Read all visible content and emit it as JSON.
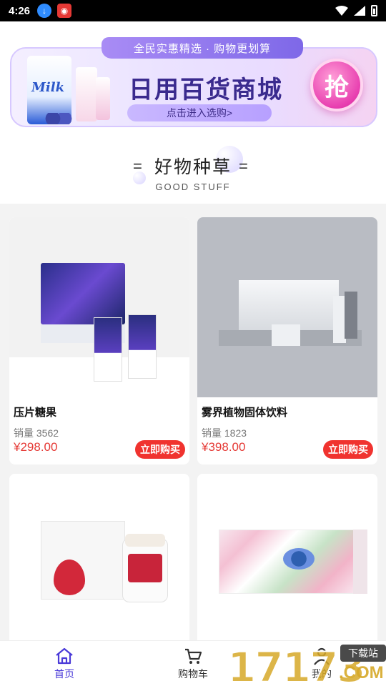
{
  "status_bar": {
    "time": "4:26",
    "icons": [
      "download-icon",
      "app-notification-icon",
      "wifi-icon",
      "signal-icon",
      "battery-icon"
    ]
  },
  "banner": {
    "tab_text": "全民实惠精选 · 购物更划算",
    "title": "日用百货商城",
    "cta": "点击进入选购>",
    "badge": "抢",
    "product_label": "Milk"
  },
  "section": {
    "title": "好物种草",
    "subtitle": "GOOD STUFF",
    "left_mark": "=",
    "right_mark": "="
  },
  "products": [
    {
      "name": "压片糖果",
      "sales_label": "销量 3562",
      "price": "¥298.00",
      "buy_label": "立即购买"
    },
    {
      "name": "雾界植物固体饮料",
      "sales_label": "销量 1823",
      "price": "¥398.00",
      "buy_label": "立即购买"
    },
    {
      "name": "",
      "sales_label": "",
      "price": "",
      "buy_label": ""
    },
    {
      "name": "",
      "sales_label": "",
      "price": "",
      "buy_label": ""
    }
  ],
  "bottom_nav": [
    {
      "label": "首页",
      "icon": "home-icon",
      "active": true
    },
    {
      "label": "购物车",
      "icon": "cart-icon",
      "active": false
    },
    {
      "label": "我的",
      "icon": "user-icon",
      "active": false
    }
  ],
  "watermark": {
    "digits": "17173",
    "domain": ".COM",
    "tag": "下载站"
  },
  "colors": {
    "accent": "#4a3ad8",
    "price": "#e53935",
    "buy_button": "#f0332f",
    "grid_background": "#f3f3f3"
  }
}
